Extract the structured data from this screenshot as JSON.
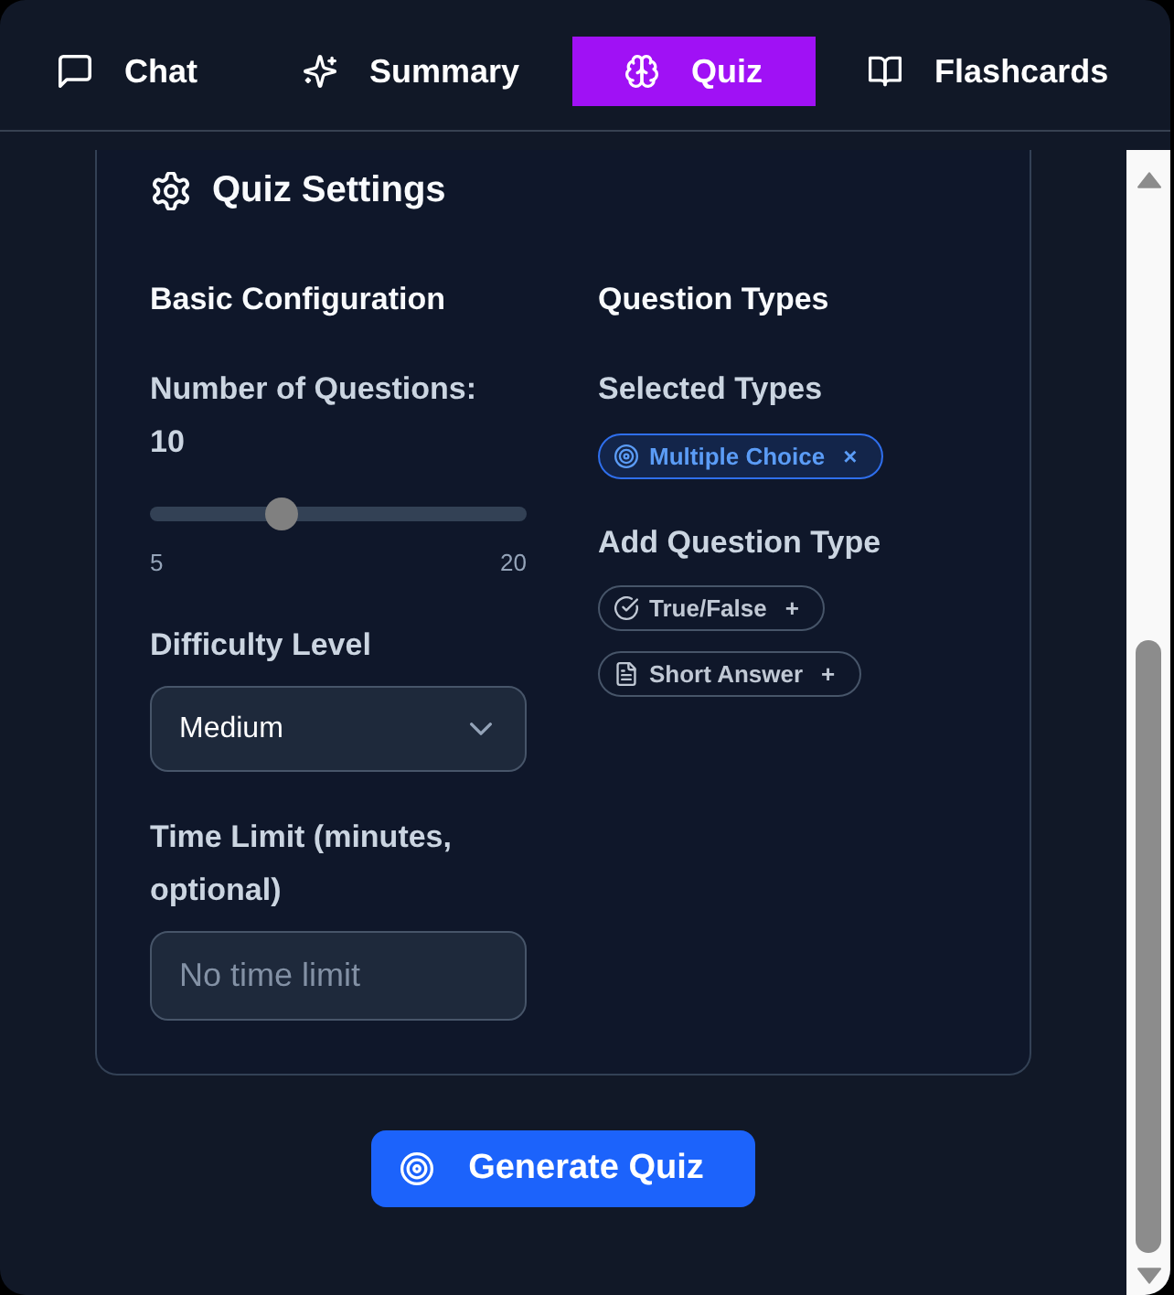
{
  "tabs": [
    {
      "kind": "chat",
      "label": "Chat",
      "selected": false
    },
    {
      "kind": "summary",
      "label": "Summary",
      "selected": false
    },
    {
      "kind": "quiz",
      "label": "Quiz",
      "selected": true
    },
    {
      "kind": "flashcards",
      "label": "Flashcards",
      "selected": false
    }
  ],
  "settings": {
    "title": "Quiz Settings",
    "basic": {
      "heading": "Basic Configuration",
      "questions": {
        "label": "Number of Questions:",
        "value": "10",
        "level": 0.333,
        "min": "5",
        "max": "20"
      },
      "difficulty": {
        "label": "Difficulty Level",
        "value": "Medium"
      },
      "time_limit": {
        "label": "Time Limit (minutes, optional)",
        "placeholder": "No time limit"
      }
    },
    "question_types": {
      "heading": "Question Types",
      "selected_label": "Selected Types",
      "add_label": "Add Question Type",
      "items": [
        {
          "kind": "choice",
          "label": "Multiple Choice",
          "sign": "×",
          "selected": true
        },
        {
          "kind": "boolean",
          "label": "True/False",
          "sign": "+",
          "selected": false
        },
        {
          "kind": "text",
          "label": "Short Answer",
          "sign": "+",
          "selected": false
        }
      ]
    }
  },
  "generate_button": {
    "label": "Generate Quiz"
  }
}
